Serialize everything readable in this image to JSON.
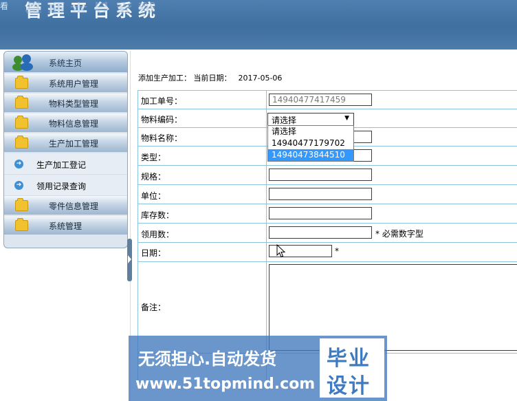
{
  "header": {
    "title": "管理平台系统",
    "cut_char": "看"
  },
  "sidebar": {
    "items": [
      {
        "label": "系统主页",
        "type": "home"
      },
      {
        "label": "系统用户管理",
        "type": "folder"
      },
      {
        "label": "物料类型管理",
        "type": "folder"
      },
      {
        "label": "物料信息管理",
        "type": "folder"
      },
      {
        "label": "生产加工管理",
        "type": "folder"
      },
      {
        "label": "生产加工登记",
        "type": "sub"
      },
      {
        "label": "领用记录查询",
        "type": "sub"
      },
      {
        "label": "零件信息管理",
        "type": "folder"
      },
      {
        "label": "系统管理",
        "type": "folder"
      }
    ]
  },
  "breadcrumb": {
    "text": "添加生产加工：  当前日期：",
    "date": "2017-05-06"
  },
  "form": {
    "order_no_label": "加工单号：",
    "order_no_value": "14940477417459",
    "material_code_label": "物料编码：",
    "material_code_selected": "请选择",
    "material_code_options": [
      "请选择",
      "14940477179702",
      "14940473844510"
    ],
    "highlighted_option_index": 2,
    "material_name_label": "物料名称：",
    "type_label": "类型：",
    "spec_label": "规格：",
    "unit_label": "单位：",
    "stock_label": "库存数：",
    "issue_label": "领用数：",
    "issue_hint": "* 必需数字型",
    "date_label": "日期：",
    "date_hint": "*",
    "remark_label": "备注："
  },
  "watermark": {
    "line1": "无须担心.自动发货",
    "line2": "www.51topmind.com",
    "stamp_top": "毕业",
    "stamp_bottom": "设计"
  },
  "colors": {
    "header": "#4a7aab",
    "table_border": "#8ac3dd",
    "highlight": "#3399ff",
    "watermark": "#4078be"
  }
}
